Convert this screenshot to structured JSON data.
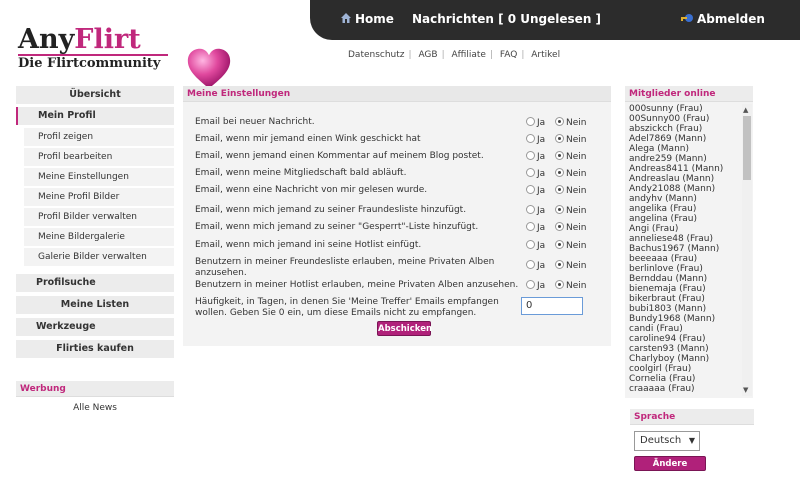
{
  "topnav": {
    "home": "Home",
    "messages": "Nachrichten [ 0 Ungelesen ]",
    "logout": "Abmelden"
  },
  "logo": {
    "part1": "Any",
    "part2": "Flirt",
    "tagline": "Die Flirtcommunity"
  },
  "links": [
    "Datenschutz",
    "AGB",
    "Affiliate",
    "FAQ",
    "Artikel"
  ],
  "sidebar": {
    "overview": "Übersicht",
    "my_profile": "Mein Profil",
    "sub": [
      "Profil zeigen",
      "Profil bearbeiten",
      "Meine Einstellungen",
      "Meine Profil Bilder",
      "Profil Bilder verwalten",
      "Meine Bildergalerie",
      "Galerie Bilder verwalten"
    ],
    "profile_search": "Profilsuche",
    "my_lists": "Meine Listen",
    "tools": "Werkzeuge",
    "buy_flirties": "Flirties kaufen"
  },
  "werbung": {
    "title": "Werbung",
    "all_news": "Alle News"
  },
  "settings": {
    "title": "Meine Einstellungen",
    "ja": "Ja",
    "nein": "Nein",
    "items": [
      "Email bei neuer Nachricht.",
      "Email, wenn mir jemand einen Wink geschickt hat",
      "Email, wenn jemand einen Kommentar auf meinem Blog postet.",
      "Email, wenn meine Mitgliedschaft bald abläuft.",
      "Email, wenn eine Nachricht von mir gelesen wurde.",
      "Email, wenn mich jemand zu seiner Fraundesliste hinzufügt.",
      "Email, wenn mich jemand zu seiner \"Gesperrt\"-Liste hinzufügt.",
      "Email, wenn mich jemand ini seine Hotlist einfügt.",
      "Benutzern in meiner Freundesliste erlauben, meine Privaten Alben anzusehen.",
      "Benutzern in meiner Hotlist erlauben, meine Privaten Alben anzusehen."
    ],
    "frequency_label": "Häufigkeit, in Tagen, in denen Sie 'Meine Treffer' Emails empfangen wollen. Geben Sie 0 ein, um diese Emails nicht zu empfangen.",
    "frequency_value": "0",
    "submit": "Abschicken"
  },
  "online": {
    "title": "Mitglieder online",
    "members": [
      "000sunny (Frau)",
      "00Sunny00 (Frau)",
      "abszickch (Frau)",
      "Adel7869 (Mann)",
      "Alega (Mann)",
      "andre259 (Mann)",
      "Andreas8411 (Mann)",
      "Andreaslau (Mann)",
      "Andy21088 (Mann)",
      "andyhv (Mann)",
      "angelika (Frau)",
      "angelina (Frau)",
      "Angi (Frau)",
      "anneliese48 (Frau)",
      "Bachus1967 (Mann)",
      "beeeaaa (Frau)",
      "berlinlove (Frau)",
      "Bernddau (Mann)",
      "bienemaja (Frau)",
      "bikerbraut (Frau)",
      "bubi1803 (Mann)",
      "Bundy1968 (Mann)",
      "candi (Frau)",
      "caroline94 (Frau)",
      "carsten93 (Mann)",
      "Charlyboy (Mann)",
      "coolgirl (Frau)",
      "Cornelia (Frau)",
      "craaaaa (Frau)"
    ]
  },
  "language": {
    "title": "Sprache",
    "selected": "Deutsch",
    "change": "Ändere Sprache"
  },
  "colors": {
    "accent": "#c0287c",
    "button": "#b0217a",
    "topbar": "#2c2c2c"
  }
}
